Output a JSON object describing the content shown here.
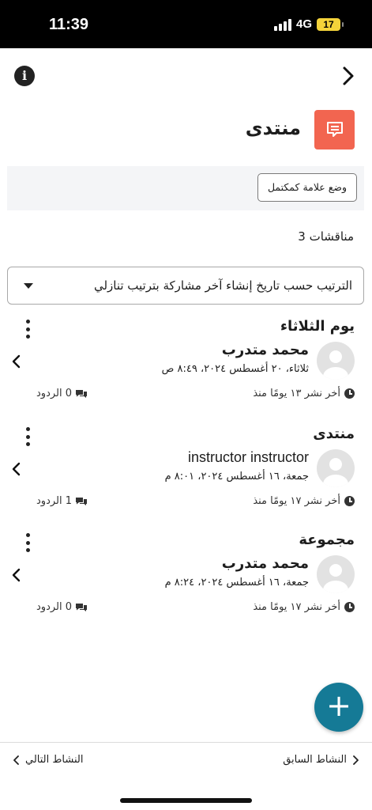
{
  "status_bar": {
    "time": "11:39",
    "network": "4G",
    "battery": "17"
  },
  "header": {
    "title": "منتدى"
  },
  "completion": {
    "mark_done_label": "وضع علامة كمكتمل"
  },
  "discussions_count_label": "مناقشات 3",
  "sort": {
    "selected": "الترتيب حسب تاريخ إنشاء آخر مشاركة بترتيب تنازلي"
  },
  "discussions": [
    {
      "subject": "يوم الثلاثاء",
      "author": "محمد متدرب",
      "date": "ثلاثاء، ٢٠ أغسطس ٢٠٢٤، ٨:٤٩ ص",
      "last_post": "أخر نشر ١٣ يومًا منذ",
      "replies": "0 الردود"
    },
    {
      "subject": "منتدى",
      "author": "instructor instructor",
      "date": "جمعة، ١٦ أغسطس ٢٠٢٤، ٨:٠١ م",
      "last_post": "أخر نشر ١٧ يومًا منذ",
      "replies": "1 الردود"
    },
    {
      "subject": "مجموعة",
      "author": "محمد متدرب",
      "date": "جمعة، ١٦ أغسطس ٢٠٢٤، ٨:٢٤ م",
      "last_post": "أخر نشر ١٧ يومًا منذ",
      "replies": "0 الردود"
    }
  ],
  "bottom_nav": {
    "previous_label": "النشاط السابق",
    "next_label": "النشاط التالي"
  },
  "colors": {
    "forum_icon_bg": "#f26550",
    "fab_bg": "#157a96",
    "battery_bg": "#f4d33a"
  },
  "icons": {
    "info": "info-icon",
    "back": "chevron-right-icon",
    "forum": "forum-icon",
    "menu": "kebab-menu-icon",
    "open": "chevron-left-icon",
    "clock": "clock-icon",
    "replies": "comments-icon",
    "add": "plus-icon"
  }
}
